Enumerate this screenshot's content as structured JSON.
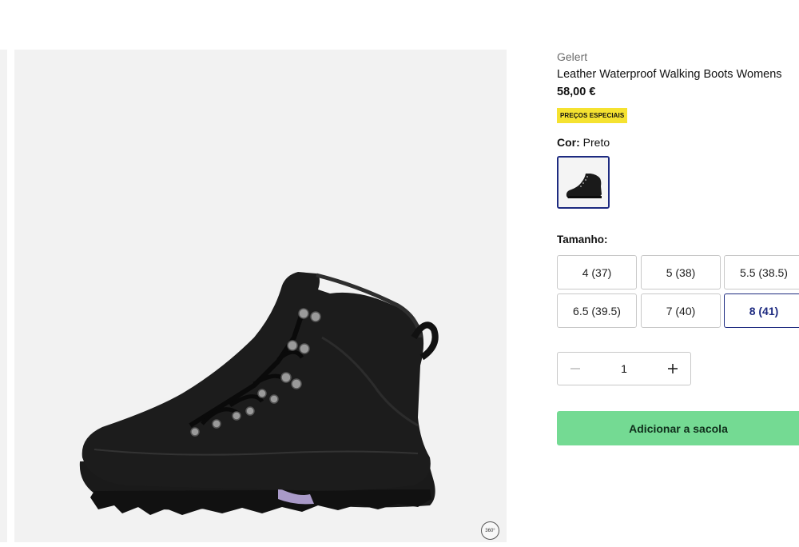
{
  "product": {
    "brand": "Gelert",
    "title": "Leather Waterproof Walking Boots Womens",
    "price": "58,00 €",
    "promo_badge": "PREÇOS ESPECIAIS"
  },
  "color": {
    "label": "Cor:",
    "value": "Preto",
    "selected_swatch": "Preto"
  },
  "size": {
    "label": "Tamanho:",
    "options": [
      {
        "label": "4 (37)",
        "selected": false
      },
      {
        "label": "5 (38)",
        "selected": false
      },
      {
        "label": "5.5 (38.5)",
        "selected": false
      },
      {
        "label": "6.5 (39.5)",
        "selected": false
      },
      {
        "label": "7 (40)",
        "selected": false
      },
      {
        "label": "8 (41)",
        "selected": true
      }
    ]
  },
  "quantity": {
    "value": "1",
    "minus_icon": "minus-icon",
    "plus_icon": "plus-icon"
  },
  "actions": {
    "add_to_bag": "Adicionar a sacola"
  },
  "gallery": {
    "badge_360": "360°"
  },
  "colors": {
    "accent": "#1d2a80",
    "cta": "#74da93",
    "promo_bg": "#f5e230",
    "gallery_bg": "#f2f2f2"
  }
}
